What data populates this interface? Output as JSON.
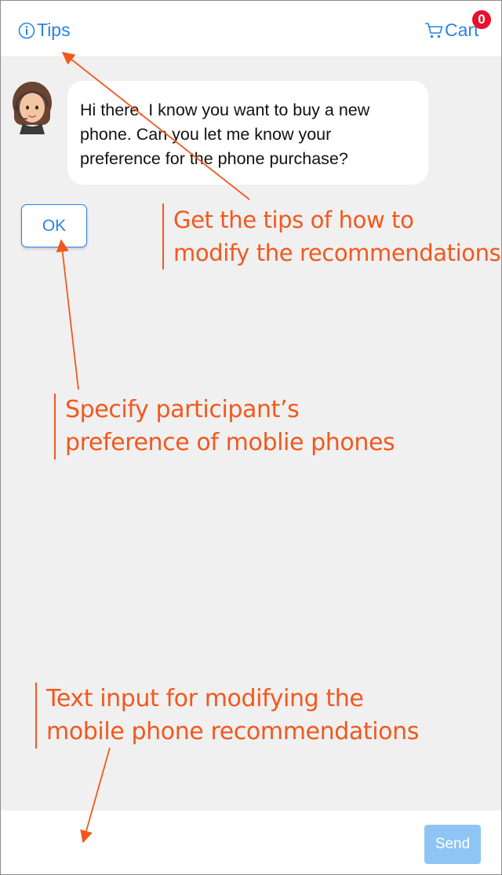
{
  "header": {
    "tips_label": "Tips",
    "cart_label": "Cart",
    "cart_count": "0",
    "tips_icon": "info-circle-icon",
    "cart_icon": "shopping-cart-icon"
  },
  "chat": {
    "agent_avatar": "agent-avatar",
    "message_lines": [
      "Hi there. I know you want to buy a new",
      "phone. Can you let me know your",
      "preference for the phone purchase?"
    ],
    "ok_button_label": "OK"
  },
  "annotations": {
    "tips": [
      "Get the tips of how to",
      "modify the recommendations"
    ],
    "ok": [
      "Specify participant’s",
      "preference of moblie phones"
    ],
    "input": [
      "Text input for modifying the",
      "mobile phone recommendations"
    ]
  },
  "input_bar": {
    "placeholder": "",
    "send_label": "Send"
  },
  "colors": {
    "accent": "#2a83e6",
    "annotation": "#f2581e",
    "badge": "#e8102c",
    "send_disabled": "#8fc5f5",
    "chat_background": "#f0f0f0"
  }
}
